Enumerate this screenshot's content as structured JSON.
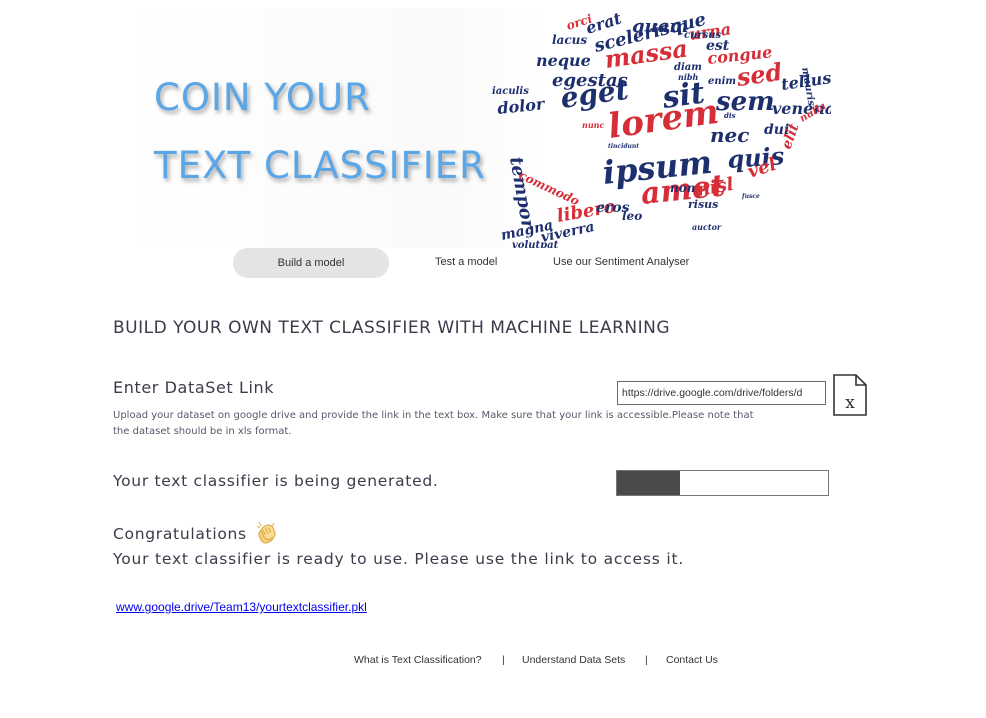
{
  "banner": {
    "title_line1": "COIN YOUR",
    "title_line2": "TEXT CLASSIFIER",
    "word_cloud": [
      "lorem",
      "ipsum",
      "amet",
      "sit",
      "sem",
      "quis",
      "eget",
      "massa",
      "sed",
      "nec",
      "neque",
      "egestas",
      "vel",
      "nisl",
      "libero",
      "viverra",
      "magna",
      "tellus",
      "congue",
      "urna",
      "erat",
      "quam",
      "scelerisque",
      "est",
      "dolor",
      "tempor",
      "venenatis",
      "dui",
      "elit",
      "commodo",
      "eros",
      "leo",
      "non",
      "risus",
      "enim",
      "cursus",
      "diam",
      "nibh",
      "lacus",
      "iaculis",
      "volutpat",
      "nulla",
      "mauris",
      "orci",
      "auctor",
      "nunc",
      "tincidunt",
      "fusce",
      "dis"
    ],
    "colors": {
      "title": "#5aa6e6",
      "cloud_navy": "#1e2f6e",
      "cloud_red": "#d62e38"
    }
  },
  "nav": {
    "build": "Build a  model",
    "test": "Test a model",
    "sentiment": "Use our Sentiment Analyser"
  },
  "main": {
    "title": "BUILD YOUR OWN TEXT CLASSIFIER WITH MACHINE LEARNING",
    "dataset": {
      "heading": "Enter DataSet Link",
      "description": "Upload your dataset on google drive and provide the link in the text box.  Make sure that your link is accessible.Please note that the dataset should be in xls format.",
      "input_value": "https://drive.google.com/drive/folders/d",
      "file_icon": "xls-file-icon"
    },
    "generation": {
      "status": "Your text classifier is being generated.",
      "progress": 0.3
    },
    "result": {
      "congrats": "Congratulations",
      "congrats_icon": "clapping-hands-icon",
      "ready": "Your text classifier is ready to use. Please use the link to access it.",
      "link": "www.google.drive/Team13/yourtextclassifier.pkl"
    }
  },
  "footer": {
    "links": [
      "What is Text Classification?",
      "Understand Data Sets",
      "Contact Us"
    ],
    "separator": "|"
  }
}
